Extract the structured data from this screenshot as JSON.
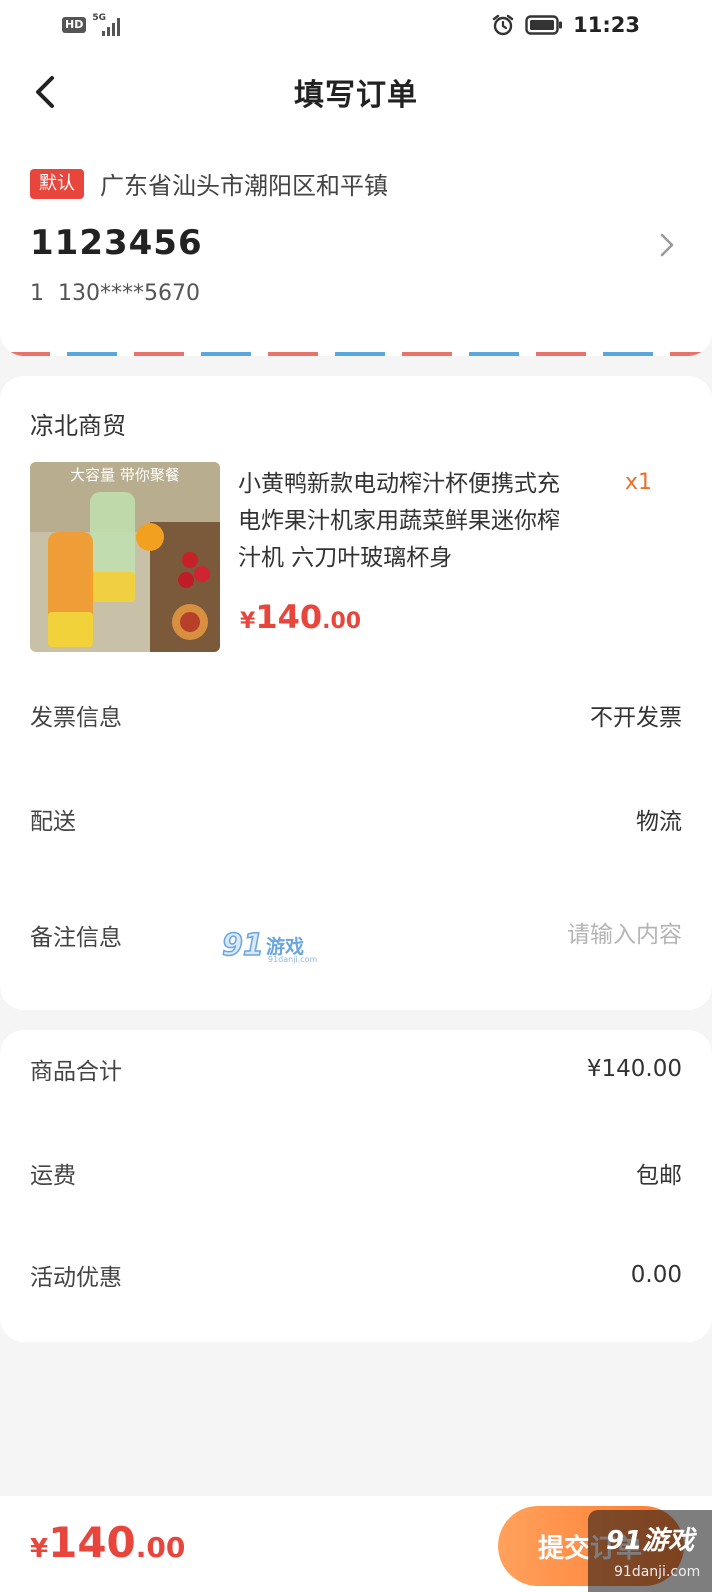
{
  "status_bar": {
    "hd": "HD",
    "network": "5G",
    "time": "11:23",
    "icons": [
      "signal-icon",
      "alarm-icon",
      "battery-icon"
    ]
  },
  "nav": {
    "title": "填写订单",
    "back_icon": "back-arrow-icon"
  },
  "address": {
    "default_label": "默认",
    "region": "广东省汕头市潮阳区和平镇",
    "name": "1123456",
    "contact": "1",
    "phone": "130****5670"
  },
  "order": {
    "shop_name": "凉北商贸",
    "product": {
      "title": "小黄鸭新款电动榨汁杯便携式充电炸果汁机家用蔬菜鲜果迷你榨汁机 六刀叶玻璃杯身",
      "quantity": "x1",
      "currency": "¥",
      "price_int": "140",
      "price_dec": ".00",
      "image_caption": "大容量 带你聚餐"
    },
    "rows": {
      "invoice_label": "发票信息",
      "invoice_value": "不开发票",
      "delivery_label": "配送",
      "delivery_value": "物流",
      "remark_label": "备注信息",
      "remark_placeholder": "请输入内容"
    }
  },
  "watermark": {
    "brand_num": "91",
    "brand_text": "游戏",
    "url": "91danji.com"
  },
  "summary": {
    "goods_total_label": "商品合计",
    "goods_total_value": "¥140.00",
    "shipping_label": "运费",
    "shipping_value": "包邮",
    "discount_label": "活动优惠",
    "discount_value": "0.00"
  },
  "bottom_bar": {
    "currency": "¥",
    "total_int": "140",
    "total_dec": ".00",
    "submit_label": "提交订单"
  },
  "corner_watermark": {
    "brand": "91游戏",
    "url": "91danji.com"
  },
  "colors": {
    "accent_red": "#e8453c",
    "accent_orange": "#ff7a2f",
    "background": "#f5f5f5"
  }
}
